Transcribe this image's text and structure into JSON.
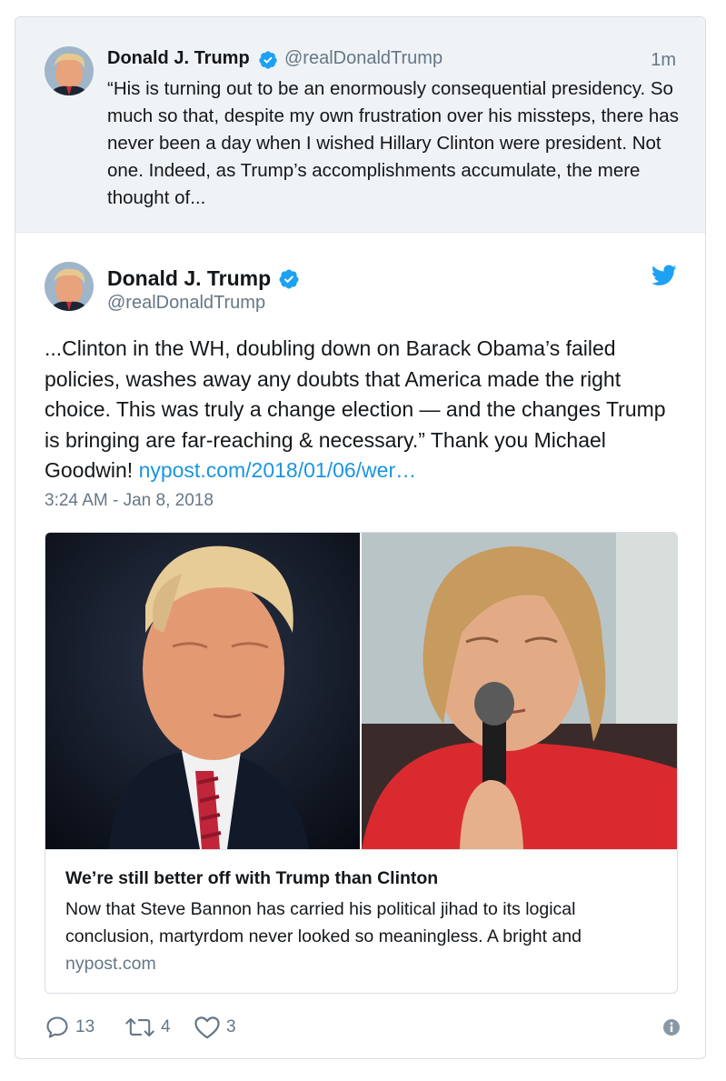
{
  "parent_tweet": {
    "name": "Donald J. Trump",
    "handle": "@realDonaldTrump",
    "time": "1m",
    "text": "“His is turning out to be an enormously consequential presidency. So much so that, despite my own frustration over his missteps, there has never been a day when I wished Hillary Clinton were president. Not one. Indeed, as Trump’s accomplishments accumulate, the mere thought of..."
  },
  "main_tweet": {
    "name": "Donald J. Trump",
    "handle": "@realDonaldTrump",
    "text": "...Clinton in the WH, doubling down on Barack Obama’s failed policies, washes away any doubts that America made the right choice. This was truly a change election — and the changes Trump is bringing are far-reaching & necessary.” Thank you Michael Goodwin!",
    "link": "nypost.com/2018/01/06/wer…",
    "date": "3:24 AM - Jan 8, 2018"
  },
  "link_card": {
    "title": "We’re still better off with Trump than Clinton",
    "description": "Now that Steve Bannon has carried his political jihad to its logical conclusion, martyrdom never looked so meaningless. A bright and",
    "domain": "nypost.com"
  },
  "actions": {
    "replies": "13",
    "retweets": "4",
    "likes": "3"
  },
  "icons": {
    "verified": "verified-badge-icon",
    "bird": "twitter-bird-icon",
    "reply": "reply-icon",
    "retweet": "retweet-icon",
    "like": "heart-icon",
    "info": "info-icon"
  },
  "colors": {
    "accent": "#1da1f2",
    "link": "#1b95e0",
    "secondary_text": "#657786",
    "parent_bg": "#f0f3f6"
  }
}
